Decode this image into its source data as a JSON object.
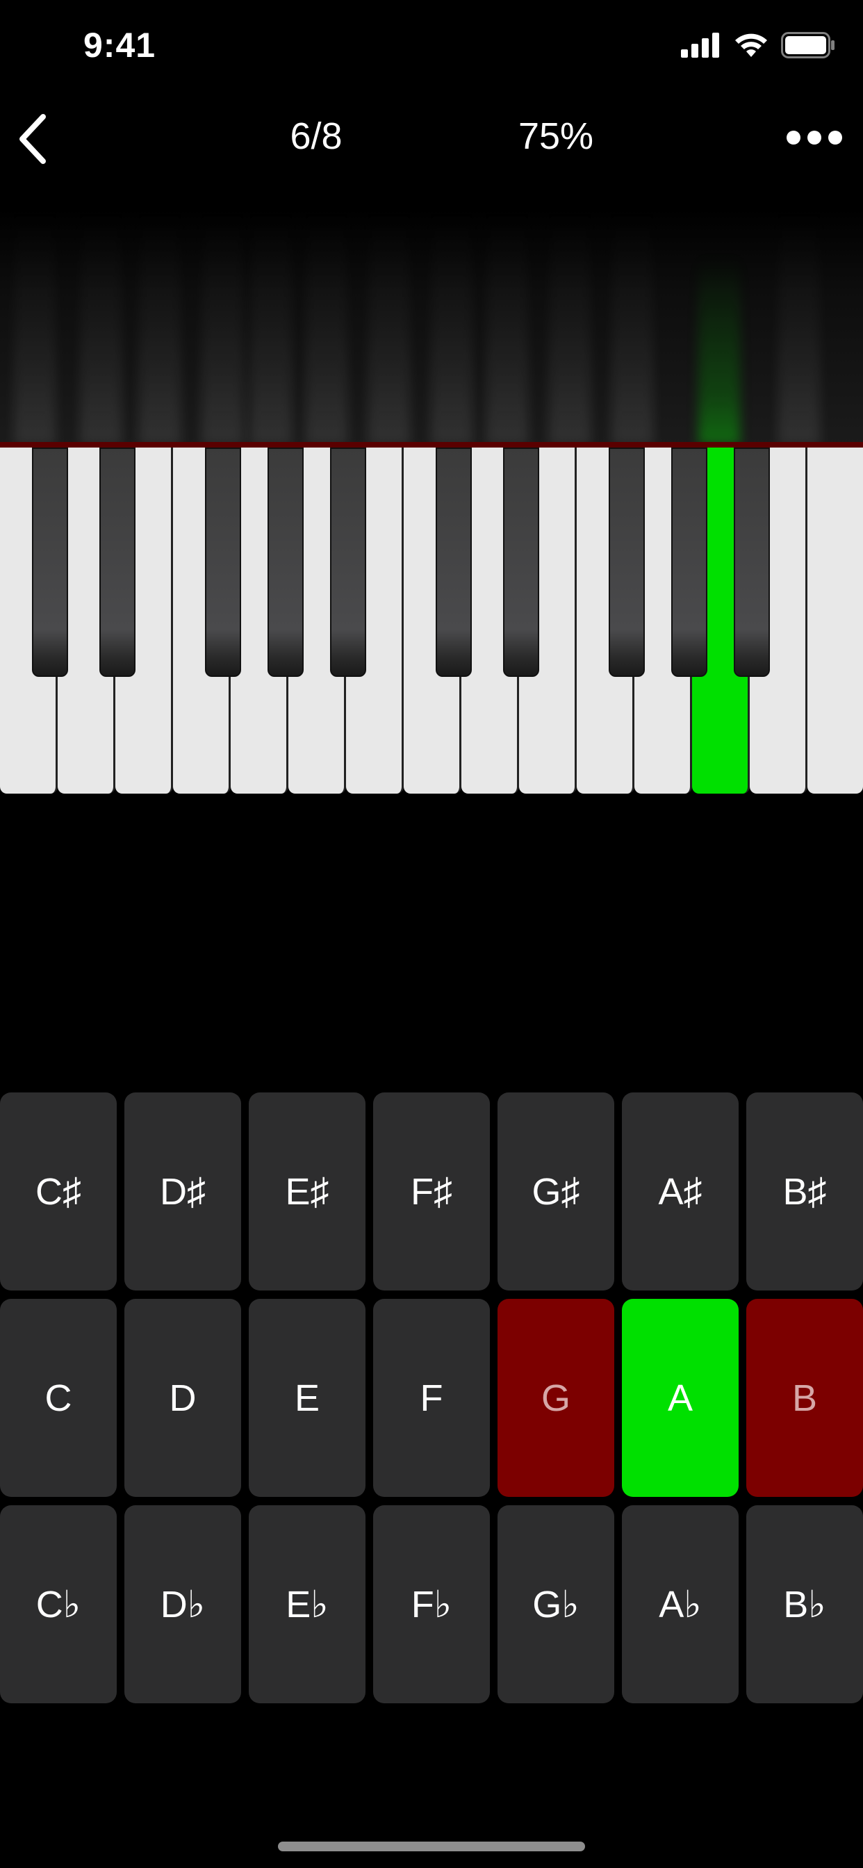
{
  "status": {
    "time": "9:41"
  },
  "nav": {
    "progress": "6/8",
    "score": "75%"
  },
  "keyboard": {
    "active_note": "A"
  },
  "answers": {
    "row1": [
      "C♯",
      "D♯",
      "E♯",
      "F♯",
      "G♯",
      "A♯",
      "B♯"
    ],
    "row2": [
      "C",
      "D",
      "E",
      "F",
      "G",
      "A",
      "B"
    ],
    "row3": [
      "C♭",
      "D♭",
      "E♭",
      "F♭",
      "G♭",
      "A♭",
      "B♭"
    ],
    "states": {
      "G": "wrong",
      "A": "correct",
      "B": "wrong"
    }
  },
  "colors": {
    "correct": "#00e000",
    "wrong": "#7c0000",
    "key_bg": "#2d2d2e"
  }
}
